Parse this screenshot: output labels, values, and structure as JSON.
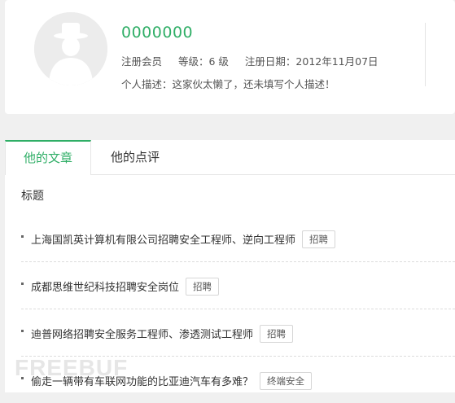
{
  "profile": {
    "username": "0000000",
    "member_type": "注册会员",
    "level": "等级：6 级",
    "register_date": "注册日期：2012年11月07日",
    "description": "个人描述：这家伙太懒了，还未填写个人描述！"
  },
  "tabs": [
    {
      "label": "他的文章",
      "active": true
    },
    {
      "label": "他的点评",
      "active": false
    }
  ],
  "list": {
    "header": "标题",
    "rows": [
      {
        "title": "上海国凯英计算机有限公司招聘安全工程师、逆向工程师",
        "tag": "招聘"
      },
      {
        "title": "成都思维世纪科技招聘安全岗位",
        "tag": "招聘"
      },
      {
        "title": "迪普网络招聘安全服务工程师、渗透测试工程师",
        "tag": "招聘"
      },
      {
        "title": "偷走一辆带有车联网功能的比亚迪汽车有多难？",
        "tag": "终端安全"
      }
    ]
  },
  "watermark": "FREEBUF",
  "colors": {
    "accent": "#2fae66",
    "background": "#f0f0f0"
  }
}
